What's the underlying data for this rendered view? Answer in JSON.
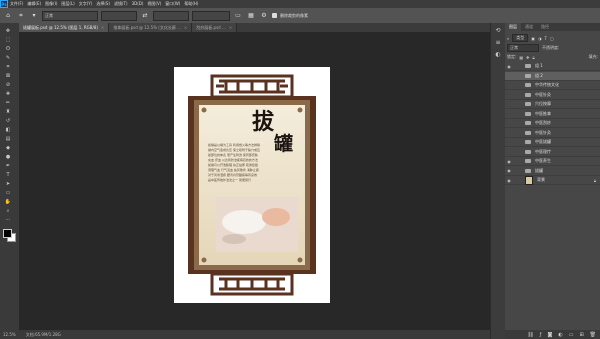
{
  "app": {
    "logo": "Ps"
  },
  "menu": [
    "文件(F)",
    "编辑(E)",
    "图像(I)",
    "图层(L)",
    "文字(Y)",
    "选择(S)",
    "滤镜(T)",
    "3D(D)",
    "视图(V)",
    "窗口(W)",
    "帮助(H)"
  ],
  "options": {
    "style_value": "正常",
    "checkbox_label": "删除裁剪的像素"
  },
  "tabs": [
    {
      "label": "拔罐展板.psd @ 12.5% (图层 1, RGB/8)",
      "active": true
    },
    {
      "label": "推拿展板.psd @ 12.5% (文化长廊 ...",
      "active": false
    },
    {
      "label": "刮痧展板.psd ...",
      "active": false
    }
  ],
  "status": {
    "zoom": "12.5%",
    "doc_info": "文档:65.9M/1.28G"
  },
  "panel": {
    "tabs": [
      "图层",
      "通道",
      "路径"
    ],
    "filter_kind": "类型",
    "blend_mode": "正常",
    "opacity_label": "不透明度:",
    "lock_label": "锁定:",
    "fill_label": "填充:"
  },
  "layers": [
    {
      "name": "组 1",
      "kind": "folder",
      "visible": true,
      "selected": false
    },
    {
      "name": "组 2",
      "kind": "folder",
      "visible": false,
      "selected": true
    },
    {
      "name": "中华传统文化",
      "kind": "folder",
      "visible": false,
      "selected": false
    },
    {
      "name": "中医针灸",
      "kind": "folder",
      "visible": false,
      "selected": false
    },
    {
      "name": "穴位按摩",
      "kind": "folder",
      "visible": false,
      "selected": false
    },
    {
      "name": "中医推拿",
      "kind": "folder",
      "visible": false,
      "selected": false
    },
    {
      "name": "中医刮痧",
      "kind": "folder",
      "visible": false,
      "selected": false
    },
    {
      "name": "中医针灸",
      "kind": "folder",
      "visible": false,
      "selected": false
    },
    {
      "name": "中医拔罐",
      "kind": "folder",
      "visible": false,
      "selected": false
    },
    {
      "name": "中医理疗",
      "kind": "folder",
      "visible": false,
      "selected": false
    },
    {
      "name": "中医养生",
      "kind": "folder",
      "visible": true,
      "selected": false
    },
    {
      "name": "拔罐",
      "kind": "folder",
      "visible": true,
      "selected": false
    },
    {
      "name": "背景",
      "kind": "background",
      "visible": true,
      "selected": false
    }
  ],
  "poster": {
    "title_char_1": "拔",
    "title_char_2": "罐",
    "body_lines": [
      "拔罐是以罐为工具 利用燃火等方法排除",
      "罐内空气造成负压 使之吸附于腧穴或应",
      "拔部位的体表 而产生刺激 使局部皮肤",
      "充血 瘀血 以达到防治疾病目的的方法",
      "拔罐可以开泄腠理 扶正祛邪 疏通经络",
      "调理气血 行气活血 祛风散寒 消肿止痛",
      "对于风寒湿痹 腰背肩臂腿痛等有良效",
      "是中医传统外治法之一 简便易行"
    ],
    "colors": {
      "frame": "#5a3220",
      "inner": "#8b6a4a",
      "paper": "#efe6d2",
      "title": "#1c1410"
    }
  }
}
